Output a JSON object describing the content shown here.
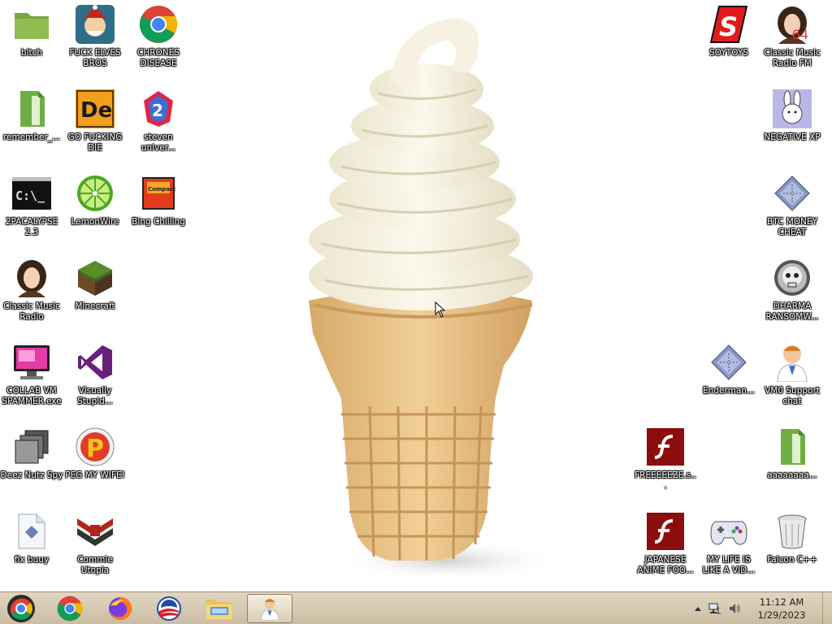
{
  "desktop": {
    "icons": [
      {
        "label": "bitch",
        "icon": "folder-icon"
      },
      {
        "label": "FUCK ELVES BROS",
        "icon": "elf-game-icon"
      },
      {
        "label": "CHRONES DISEASE",
        "icon": "chrome-icon"
      },
      {
        "label": "remember_...",
        "icon": "green-archive-icon"
      },
      {
        "label": "GO FUCKING DIE",
        "icon": "de-app-icon"
      },
      {
        "label": "steven univer...",
        "icon": "steven-universe-icon"
      },
      {
        "label": "2PACALYPSE 2.3",
        "icon": "terminal-icon"
      },
      {
        "label": "LemonWire",
        "icon": "limewire-icon"
      },
      {
        "label": "Bing Chilling",
        "icon": "compact-flash-icon"
      },
      {
        "label": "Classic Music Radio",
        "icon": "portrait-icon"
      },
      {
        "label": "Minecraft",
        "icon": "minecraft-icon"
      },
      {
        "label": "COLLAB VM SPAMMER.exe",
        "icon": "monitor-icon"
      },
      {
        "label": "Visually Stupid...",
        "icon": "visual-studio-icon"
      },
      {
        "label": "Deez Nutz Spy",
        "icon": "windows-stack-icon"
      },
      {
        "label": "PEG MY WIFE!",
        "icon": "p-logo-icon"
      },
      {
        "label": "fix buuy",
        "icon": "script-file-icon"
      },
      {
        "label": "Commie Utopia",
        "icon": "arstotzka-icon"
      },
      {
        "label": "SOYTOYS",
        "icon": "red-s-icon"
      },
      {
        "label": "Classic Music Radio FM",
        "icon": "portrait-64-icon"
      },
      {
        "label": "NEGATIVE XP",
        "icon": "bunny-icon"
      },
      {
        "label": "BTC MONEY CHEAT",
        "icon": "diamond-icon"
      },
      {
        "label": "DHARMA RANSOMW...",
        "icon": "skull-icon"
      },
      {
        "label": "Enderman...",
        "icon": "diamond-icon"
      },
      {
        "label": "VM0 Support chat",
        "icon": "support-agent-icon"
      },
      {
        "label": "FREEEEEZE.s...",
        "icon": "flash-icon"
      },
      {
        "label": "aaaaaaaa...",
        "icon": "green-archive-icon"
      },
      {
        "label": "JAPANESE ANIME FOO...",
        "icon": "flash-icon"
      },
      {
        "label": "MY LIFE IS LIKE A VID...",
        "icon": "gamepad-icon"
      },
      {
        "label": "Falcon C++",
        "icon": "recycle-bin-icon"
      }
    ],
    "portrait_badge": "64"
  },
  "taskbar": {
    "start": "start-orb-icon",
    "pinned": [
      "chrome-icon",
      "firefox-icon",
      "obama-logo-icon",
      "file-explorer-icon",
      "support-agent-icon"
    ],
    "active_index": 4,
    "tray": {
      "icons": [
        "chevron-up-icon",
        "network-icon",
        "volume-icon"
      ],
      "time": "11:12 AM",
      "date": "1/29/2023"
    }
  },
  "colors": {
    "taskbar_top": "#e1d6c3",
    "taskbar_bottom": "#cbbda2",
    "desktop_bg": "#ffffff"
  }
}
